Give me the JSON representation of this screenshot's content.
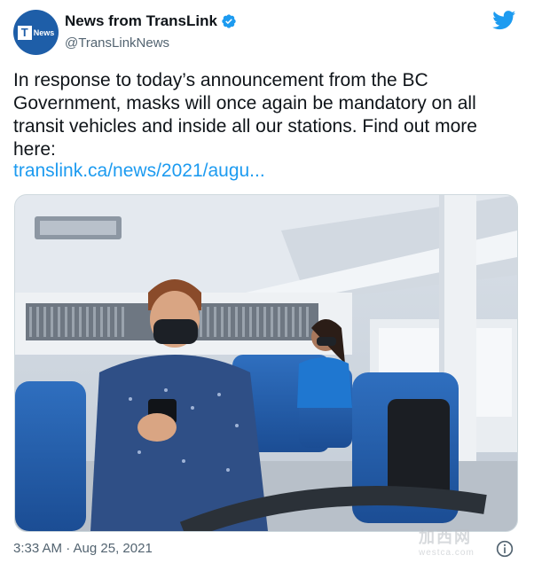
{
  "tweet": {
    "author": {
      "display_name": "News from TransLink",
      "handle": "@TransLinkNews",
      "avatar_letter": "T",
      "avatar_word": "News",
      "verified": true
    },
    "text": "In response to today’s announcement from the BC Government, masks will once again be mandatory on all transit vehicles and inside all our stations. Find out more here:",
    "link": "translink.ca/news/2021/augu...",
    "timestamp": "3:33 AM · Aug 25, 2021",
    "media_description": "photo-bus-interior-masked-passengers"
  },
  "watermark": {
    "top": "加西网",
    "bottom": "westca.com"
  },
  "colors": {
    "brand": "#1e5ea8",
    "link": "#1d9bf0",
    "verified": "#1d9bf0",
    "muted": "#536471"
  }
}
